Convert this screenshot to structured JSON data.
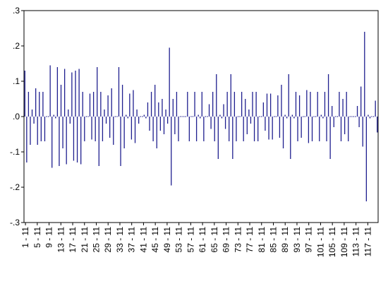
{
  "chart_data": {
    "type": "bar",
    "title": "",
    "xlabel": "",
    "ylabel": "",
    "ylim": [
      -0.3,
      0.3
    ],
    "y_ticks": [
      ".3",
      ".2",
      ".1",
      ".0",
      "-.1",
      "-.2",
      "-.3"
    ],
    "x_ticks": [
      "1 - 11",
      "5 - 11",
      "9 - 11",
      "13 - 11",
      "17 - 11",
      "21 - 11",
      "25 - 11",
      "29 - 11",
      "33 - 11",
      "37 - 11",
      "41 - 11",
      "45 - 11",
      "49 - 11",
      "53 - 11",
      "57 - 11",
      "61 - 11",
      "65 - 11",
      "69 - 11",
      "73 - 11",
      "77 - 11",
      "81 - 11",
      "85 - 11",
      "89 - 11",
      "93 - 11",
      "97 - 11",
      "101 - 11",
      "105 - 11",
      "109 - 11",
      "113 - 11",
      "117 - 11"
    ],
    "grid": false,
    "legend": "none",
    "colors": {
      "bar": "#1f1f8f",
      "frame": "#000000",
      "background": "#ffffff"
    },
    "values": [
      0.13,
      -0.13,
      0.07,
      -0.08,
      0.02,
      -0.02,
      0.08,
      -0.08,
      0.07,
      -0.07,
      0.07,
      -0.07,
      0.0,
      0.0,
      0.145,
      -0.145,
      0.005,
      -0.005,
      0.14,
      -0.14,
      0.09,
      -0.09,
      0.135,
      -0.135,
      0.02,
      -0.02,
      0.125,
      -0.125,
      0.13,
      -0.13,
      0.135,
      -0.135,
      0.07,
      -0.07,
      0.0,
      0.0,
      0.065,
      -0.065,
      0.07,
      -0.07,
      0.14,
      -0.14,
      0.07,
      -0.07,
      0.02,
      -0.02,
      0.06,
      -0.06,
      0.08,
      -0.08,
      0.0,
      0.0,
      0.14,
      -0.14,
      0.09,
      -0.09,
      0.005,
      -0.005,
      0.065,
      -0.065,
      0.075,
      -0.075,
      0.02,
      -0.02,
      0.0,
      0.0,
      0.005,
      -0.005,
      0.04,
      -0.04,
      0.07,
      -0.07,
      0.09,
      -0.09,
      0.04,
      -0.04,
      0.05,
      -0.05,
      0.02,
      -0.02,
      0.195,
      -0.195,
      0.05,
      -0.05,
      0.07,
      -0.07,
      0.0,
      0.0,
      0.0,
      0.0,
      0.07,
      -0.07,
      0.0,
      0.0,
      0.07,
      -0.07,
      0.005,
      -0.005,
      0.07,
      -0.07,
      0.0,
      0.0,
      0.035,
      -0.035,
      0.07,
      -0.07,
      0.12,
      -0.12,
      0.005,
      -0.005,
      0.035,
      -0.035,
      0.07,
      -0.07,
      0.12,
      -0.12,
      0.07,
      -0.07,
      0.0,
      0.0,
      0.07,
      -0.07,
      0.05,
      -0.05,
      0.02,
      -0.02,
      0.07,
      -0.07,
      0.07,
      -0.07,
      0.0,
      0.0,
      0.04,
      -0.04,
      0.065,
      -0.065,
      0.065,
      -0.065,
      0.0,
      0.0,
      0.06,
      -0.06,
      0.09,
      -0.09,
      0.005,
      -0.005,
      0.12,
      -0.12,
      0.005,
      -0.005,
      0.07,
      -0.07,
      0.06,
      -0.06,
      0.0,
      0.0,
      0.075,
      -0.075,
      0.07,
      -0.07,
      0.0,
      0.0,
      0.07,
      -0.07,
      0.005,
      -0.005,
      0.07,
      -0.07,
      0.12,
      -0.12,
      0.03,
      -0.03,
      0.0,
      0.0,
      0.07,
      -0.07,
      0.05,
      -0.05,
      0.07,
      -0.07,
      0.0,
      0.0,
      0.0,
      0.0,
      0.03,
      -0.03,
      0.085,
      -0.085,
      0.24,
      -0.24,
      0.005,
      -0.005,
      0.0,
      0.0,
      0.045,
      -0.045
    ]
  }
}
